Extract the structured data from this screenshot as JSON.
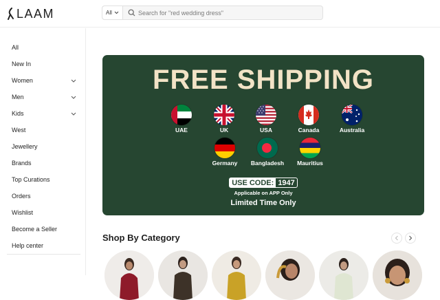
{
  "header": {
    "logo_text": "LAAM",
    "search_scope": "All",
    "search_placeholder": "Search for \"red wedding dress\""
  },
  "sidebar": {
    "items": [
      {
        "label": "All",
        "has_chevron": false
      },
      {
        "label": "New In",
        "has_chevron": false
      },
      {
        "label": "Women",
        "has_chevron": true
      },
      {
        "label": "Men",
        "has_chevron": true
      },
      {
        "label": "Kids",
        "has_chevron": true
      },
      {
        "label": "West",
        "has_chevron": false
      },
      {
        "label": "Jewellery",
        "has_chevron": false
      },
      {
        "label": "Brands",
        "has_chevron": false
      },
      {
        "label": "Top Curations",
        "has_chevron": false
      },
      {
        "label": "Orders",
        "has_chevron": false
      },
      {
        "label": "Wishlist",
        "has_chevron": false
      },
      {
        "label": "Become a Seller",
        "has_chevron": false
      },
      {
        "label": "Help center",
        "has_chevron": false
      }
    ]
  },
  "banner": {
    "title": "FREE SHIPPING",
    "countries": [
      "UAE",
      "UK",
      "USA",
      "Canada",
      "Australia",
      "Germany",
      "Bangladesh",
      "Mauritius"
    ],
    "code_label": "USE CODE:",
    "code_value": "1947",
    "applicable": "Applicable on APP Only",
    "limited": "Limited Time Only",
    "background_color": "#264631",
    "title_color": "#f2e3c6"
  },
  "categories": {
    "title": "Shop By Category",
    "prev_icon": "chevron-left-icon",
    "next_icon": "chevron-right-icon"
  }
}
